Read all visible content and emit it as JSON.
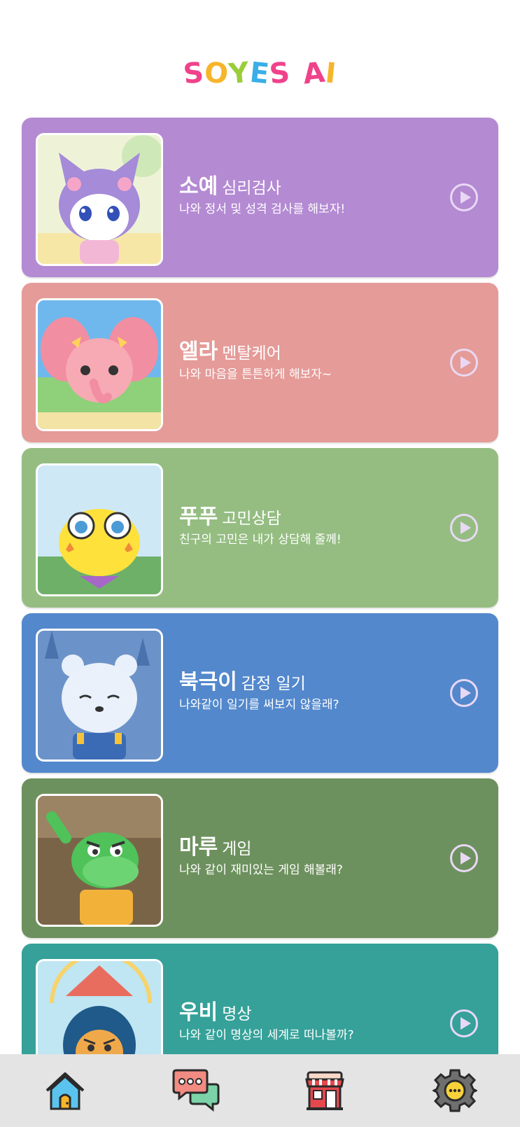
{
  "logo": {
    "letters": [
      "S",
      "O",
      "Y",
      "E",
      "S",
      " ",
      "A",
      "I"
    ],
    "colors": [
      "#f0428a",
      "#f7b52b",
      "#9bcd3a",
      "#3aaee8",
      "#f0428a",
      "#ffffff",
      "#f0428a",
      "#f7b52b"
    ]
  },
  "cards": [
    {
      "name": "소예",
      "sub": "심리검사",
      "desc": "나와 정서 및 성격 검사를 해보자!",
      "color": "#b48ad3",
      "character": "purple-cat-character"
    },
    {
      "name": "엘라",
      "sub": "멘탈케어",
      "desc": "나와 마음을 튼튼하게 해보자~",
      "color": "#e59b98",
      "character": "pink-elephant-character"
    },
    {
      "name": "푸푸",
      "sub": "고민상담",
      "desc": "친구의 고민은 내가 상담해 줄께!",
      "color": "#95bd82",
      "character": "yellow-frog-character"
    },
    {
      "name": "북극이",
      "sub": "감정 일기",
      "desc": "나와같이 일기를 써보지 않을래?",
      "color": "#5388cc",
      "character": "polar-bear-character"
    },
    {
      "name": "마루",
      "sub": "게임",
      "desc": "나와 같이 재미있는 게임 해볼래?",
      "color": "#6d915e",
      "character": "green-dragon-character"
    },
    {
      "name": "우비",
      "sub": "명상",
      "desc": "나와 같이 명상의 세계로 떠나볼까?",
      "color": "#35a199",
      "character": "raincoat-character"
    }
  ],
  "navbar": [
    "home-icon",
    "chat-icon",
    "store-icon",
    "settings-icon"
  ]
}
